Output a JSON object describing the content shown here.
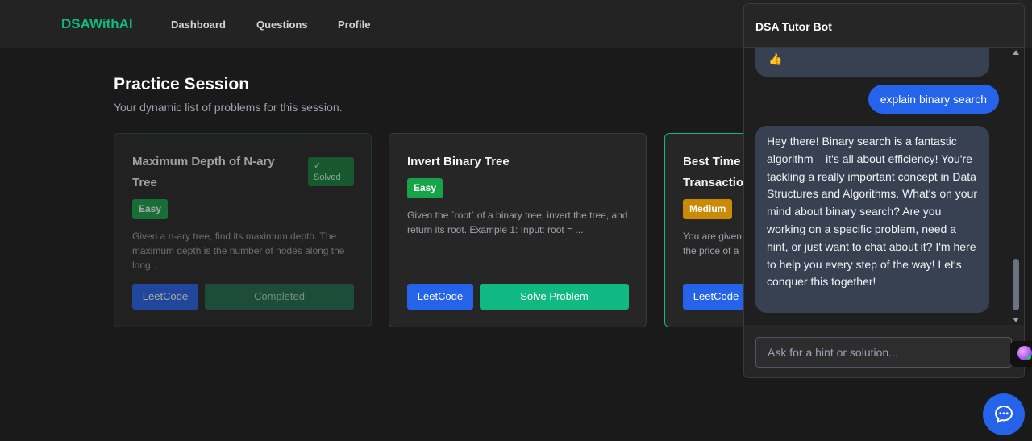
{
  "nav": {
    "brand": "DSAWithAI",
    "links": [
      "Dashboard",
      "Questions",
      "Profile"
    ]
  },
  "page": {
    "title": "Practice Session",
    "subtitle": "Your dynamic list of problems for this session."
  },
  "problems": [
    {
      "title": "Maximum Depth of N-ary Tree",
      "difficulty": "Easy",
      "status_icon": "✓",
      "status_label": "Solved",
      "description": "Given a n-ary tree, find its maximum depth. The maximum depth is the number of nodes along the long...",
      "leetcode_label": "LeetCode",
      "action_label": "Completed"
    },
    {
      "title": "Invert Binary Tree",
      "difficulty": "Easy",
      "description": "Given the `root` of a binary tree, invert the tree, and return its root. Example 1: Input: root = ...",
      "leetcode_label": "LeetCode",
      "action_label": "Solve Problem"
    },
    {
      "title": "Best Time Transactio",
      "difficulty": "Medium",
      "description": "You are given the price of a",
      "leetcode_label": "LeetCode"
    }
  ],
  "chat": {
    "title": "DSA Tutor Bot",
    "prev_emoji": "👍",
    "user_message": "explain binary search",
    "bot_message": "Hey there! Binary search is a fantastic algorithm – it's all about efficiency! You're tackling a really important concept in Data Structures and Algorithms. What's on your mind about binary search? Are you working on a specific problem, need a hint, or just want to chat about it? I'm here to help you every step of the way! Let's conquer this together!",
    "input_placeholder": "Ask for a hint or solution..."
  },
  "colors": {
    "accent": "#10b981",
    "primary": "#2563eb",
    "easy": "#16a34a",
    "medium": "#ca8a04"
  }
}
